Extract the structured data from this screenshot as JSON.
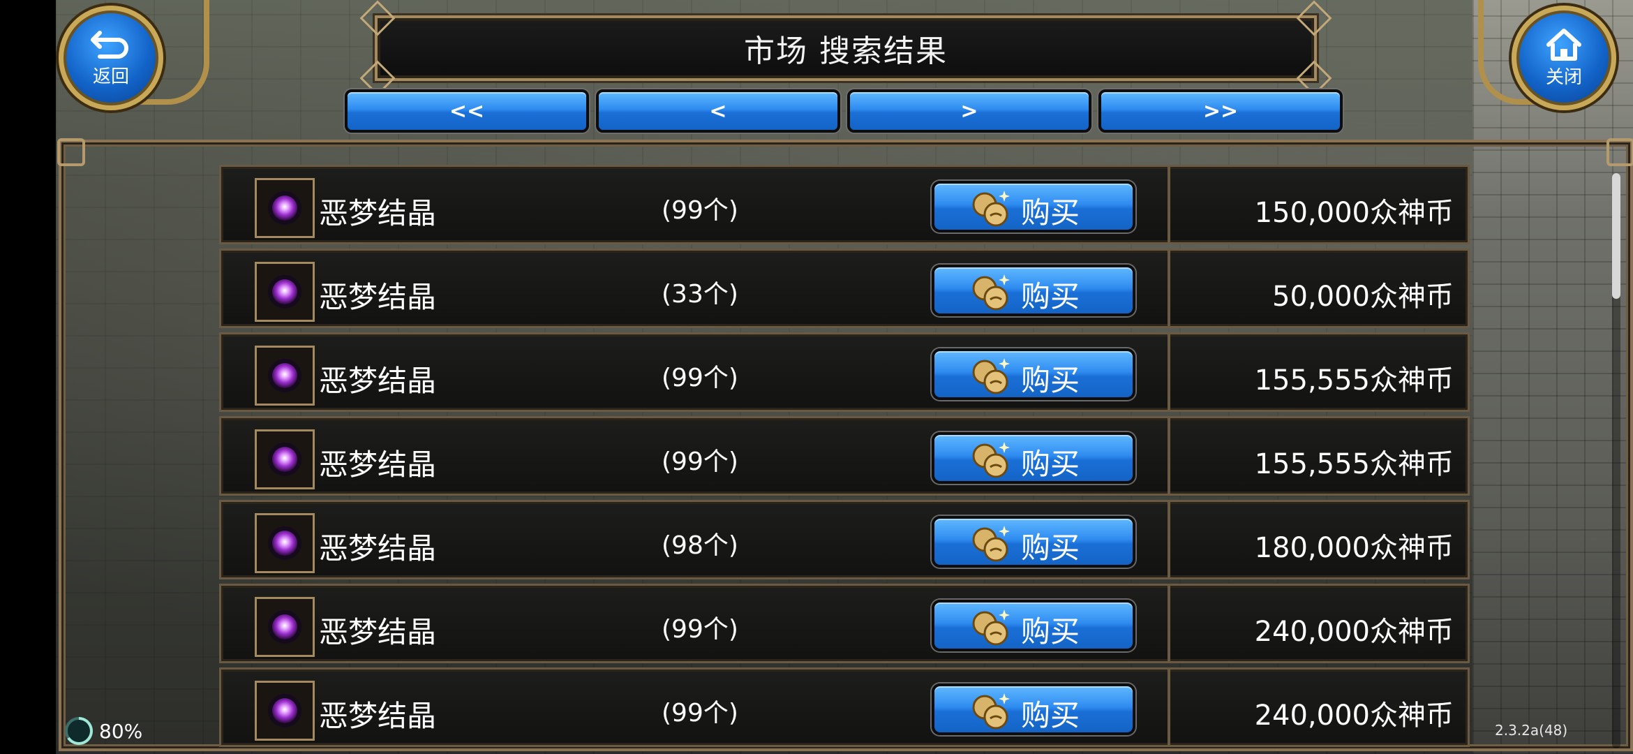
{
  "header": {
    "title": "市场 搜索结果",
    "back_label": "返回",
    "close_label": "关闭"
  },
  "pagination": {
    "first": "<<",
    "prev": "<",
    "next": ">",
    "last": ">>"
  },
  "listings": [
    {
      "name": "恶梦结晶",
      "qty": "(99个)",
      "buy_label": "购买",
      "price": "150,000众神币"
    },
    {
      "name": "恶梦结晶",
      "qty": "(33个)",
      "buy_label": "购买",
      "price": "50,000众神币"
    },
    {
      "name": "恶梦结晶",
      "qty": "(99个)",
      "buy_label": "购买",
      "price": "155,555众神币"
    },
    {
      "name": "恶梦结晶",
      "qty": "(99个)",
      "buy_label": "购买",
      "price": "155,555众神币"
    },
    {
      "name": "恶梦结晶",
      "qty": "(98个)",
      "buy_label": "购买",
      "price": "180,000众神币"
    },
    {
      "name": "恶梦结晶",
      "qty": "(99个)",
      "buy_label": "购买",
      "price": "240,000众神币"
    },
    {
      "name": "恶梦结晶",
      "qty": "(99个)",
      "buy_label": "购买",
      "price": "240,000众神币"
    }
  ],
  "status": {
    "battery": "80%",
    "version": "2.3.2a(48)"
  },
  "icons": {
    "back": "back-arrow-icon",
    "close": "home-icon",
    "item": "purple-orb-icon",
    "buy": "coin-icon",
    "battery": "battery-ring-icon"
  },
  "colors": {
    "button_blue": "#2f8cf0",
    "frame_gold": "#a48a60",
    "row_bg": "#1d1d1b"
  }
}
